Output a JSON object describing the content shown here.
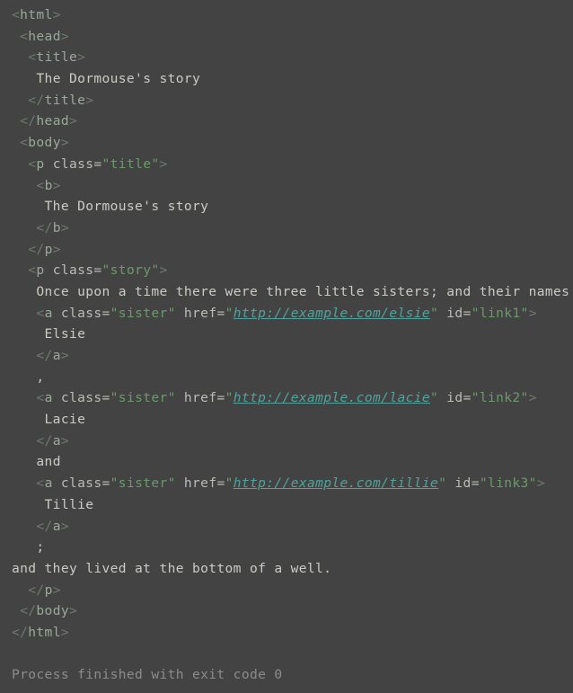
{
  "console": {
    "background": "#434343",
    "exit_message": "Process finished with exit code 0",
    "colors": {
      "background": "#434343",
      "bracket": "#6d7a6d",
      "tag_name": "#9aa89a",
      "attr_name": "#b9bcb6",
      "attr_value": "#6a9a6a",
      "url_link": "#4fa39c",
      "plain_text": "#c9ccc4",
      "exit_text": "#8c8c8c"
    },
    "lines": [
      {
        "indent": 0,
        "tokens": [
          {
            "t": "bracket",
            "v": "<"
          },
          {
            "t": "tag",
            "v": "html"
          },
          {
            "t": "bracket",
            "v": ">"
          }
        ]
      },
      {
        "indent": 1,
        "tokens": [
          {
            "t": "bracket",
            "v": "<"
          },
          {
            "t": "tag",
            "v": "head"
          },
          {
            "t": "bracket",
            "v": ">"
          }
        ]
      },
      {
        "indent": 2,
        "tokens": [
          {
            "t": "bracket",
            "v": "<"
          },
          {
            "t": "tag",
            "v": "title"
          },
          {
            "t": "bracket",
            "v": ">"
          }
        ]
      },
      {
        "indent": 3,
        "tokens": [
          {
            "t": "text",
            "v": "The Dormouse's story"
          }
        ]
      },
      {
        "indent": 2,
        "tokens": [
          {
            "t": "bracket",
            "v": "</"
          },
          {
            "t": "tag",
            "v": "title"
          },
          {
            "t": "bracket",
            "v": ">"
          }
        ]
      },
      {
        "indent": 1,
        "tokens": [
          {
            "t": "bracket",
            "v": "</"
          },
          {
            "t": "tag",
            "v": "head"
          },
          {
            "t": "bracket",
            "v": ">"
          }
        ]
      },
      {
        "indent": 1,
        "tokens": [
          {
            "t": "bracket",
            "v": "<"
          },
          {
            "t": "tag",
            "v": "body"
          },
          {
            "t": "bracket",
            "v": ">"
          }
        ]
      },
      {
        "indent": 2,
        "tokens": [
          {
            "t": "bracket",
            "v": "<"
          },
          {
            "t": "tag",
            "v": "p"
          },
          {
            "t": "text",
            "v": " "
          },
          {
            "t": "attr",
            "v": "class="
          },
          {
            "t": "val",
            "v": "\"title\""
          },
          {
            "t": "bracket",
            "v": ">"
          }
        ]
      },
      {
        "indent": 3,
        "tokens": [
          {
            "t": "bracket",
            "v": "<"
          },
          {
            "t": "tag",
            "v": "b"
          },
          {
            "t": "bracket",
            "v": ">"
          }
        ]
      },
      {
        "indent": 4,
        "tokens": [
          {
            "t": "text",
            "v": "The Dormouse's story"
          }
        ]
      },
      {
        "indent": 3,
        "tokens": [
          {
            "t": "bracket",
            "v": "</"
          },
          {
            "t": "tag",
            "v": "b"
          },
          {
            "t": "bracket",
            "v": ">"
          }
        ]
      },
      {
        "indent": 2,
        "tokens": [
          {
            "t": "bracket",
            "v": "</"
          },
          {
            "t": "tag",
            "v": "p"
          },
          {
            "t": "bracket",
            "v": ">"
          }
        ]
      },
      {
        "indent": 2,
        "tokens": [
          {
            "t": "bracket",
            "v": "<"
          },
          {
            "t": "tag",
            "v": "p"
          },
          {
            "t": "text",
            "v": " "
          },
          {
            "t": "attr",
            "v": "class="
          },
          {
            "t": "val",
            "v": "\"story\""
          },
          {
            "t": "bracket",
            "v": ">"
          }
        ]
      },
      {
        "indent": 3,
        "tokens": [
          {
            "t": "text",
            "v": "Once upon a time there were three little sisters; and their names were"
          }
        ]
      },
      {
        "indent": 3,
        "tokens": [
          {
            "t": "bracket",
            "v": "<"
          },
          {
            "t": "tag",
            "v": "a"
          },
          {
            "t": "text",
            "v": " "
          },
          {
            "t": "attr",
            "v": "class="
          },
          {
            "t": "val",
            "v": "\"sister\""
          },
          {
            "t": "text",
            "v": " "
          },
          {
            "t": "attr",
            "v": "href="
          },
          {
            "t": "val",
            "v": "\""
          },
          {
            "t": "url",
            "v": "http://example.com/elsie"
          },
          {
            "t": "val",
            "v": "\""
          },
          {
            "t": "text",
            "v": " "
          },
          {
            "t": "attr",
            "v": "id="
          },
          {
            "t": "val",
            "v": "\"link1\""
          },
          {
            "t": "bracket",
            "v": ">"
          }
        ]
      },
      {
        "indent": 4,
        "tokens": [
          {
            "t": "text",
            "v": "Elsie"
          }
        ]
      },
      {
        "indent": 3,
        "tokens": [
          {
            "t": "bracket",
            "v": "</"
          },
          {
            "t": "tag",
            "v": "a"
          },
          {
            "t": "bracket",
            "v": ">"
          }
        ]
      },
      {
        "indent": 3,
        "tokens": [
          {
            "t": "text",
            "v": ","
          }
        ]
      },
      {
        "indent": 3,
        "tokens": [
          {
            "t": "bracket",
            "v": "<"
          },
          {
            "t": "tag",
            "v": "a"
          },
          {
            "t": "text",
            "v": " "
          },
          {
            "t": "attr",
            "v": "class="
          },
          {
            "t": "val",
            "v": "\"sister\""
          },
          {
            "t": "text",
            "v": " "
          },
          {
            "t": "attr",
            "v": "href="
          },
          {
            "t": "val",
            "v": "\""
          },
          {
            "t": "url",
            "v": "http://example.com/lacie"
          },
          {
            "t": "val",
            "v": "\""
          },
          {
            "t": "text",
            "v": " "
          },
          {
            "t": "attr",
            "v": "id="
          },
          {
            "t": "val",
            "v": "\"link2\""
          },
          {
            "t": "bracket",
            "v": ">"
          }
        ]
      },
      {
        "indent": 4,
        "tokens": [
          {
            "t": "text",
            "v": "Lacie"
          }
        ]
      },
      {
        "indent": 3,
        "tokens": [
          {
            "t": "bracket",
            "v": "</"
          },
          {
            "t": "tag",
            "v": "a"
          },
          {
            "t": "bracket",
            "v": ">"
          }
        ]
      },
      {
        "indent": 3,
        "tokens": [
          {
            "t": "text",
            "v": "and"
          }
        ]
      },
      {
        "indent": 3,
        "tokens": [
          {
            "t": "bracket",
            "v": "<"
          },
          {
            "t": "tag",
            "v": "a"
          },
          {
            "t": "text",
            "v": " "
          },
          {
            "t": "attr",
            "v": "class="
          },
          {
            "t": "val",
            "v": "\"sister\""
          },
          {
            "t": "text",
            "v": " "
          },
          {
            "t": "attr",
            "v": "href="
          },
          {
            "t": "val",
            "v": "\""
          },
          {
            "t": "url",
            "v": "http://example.com/tillie"
          },
          {
            "t": "val",
            "v": "\""
          },
          {
            "t": "text",
            "v": " "
          },
          {
            "t": "attr",
            "v": "id="
          },
          {
            "t": "val",
            "v": "\"link3\""
          },
          {
            "t": "bracket",
            "v": ">"
          }
        ]
      },
      {
        "indent": 4,
        "tokens": [
          {
            "t": "text",
            "v": "Tillie"
          }
        ]
      },
      {
        "indent": 3,
        "tokens": [
          {
            "t": "bracket",
            "v": "</"
          },
          {
            "t": "tag",
            "v": "a"
          },
          {
            "t": "bracket",
            "v": ">"
          }
        ]
      },
      {
        "indent": 3,
        "tokens": [
          {
            "t": "text",
            "v": ";"
          }
        ]
      },
      {
        "indent": 0,
        "tokens": [
          {
            "t": "text",
            "v": "and they lived at the bottom of a well."
          }
        ]
      },
      {
        "indent": 2,
        "tokens": [
          {
            "t": "bracket",
            "v": "</"
          },
          {
            "t": "tag",
            "v": "p"
          },
          {
            "t": "bracket",
            "v": ">"
          }
        ]
      },
      {
        "indent": 1,
        "tokens": [
          {
            "t": "bracket",
            "v": "</"
          },
          {
            "t": "tag",
            "v": "body"
          },
          {
            "t": "bracket",
            "v": ">"
          }
        ]
      },
      {
        "indent": 0,
        "tokens": [
          {
            "t": "bracket",
            "v": "</"
          },
          {
            "t": "tag",
            "v": "html"
          },
          {
            "t": "bracket",
            "v": ">"
          }
        ]
      }
    ]
  }
}
